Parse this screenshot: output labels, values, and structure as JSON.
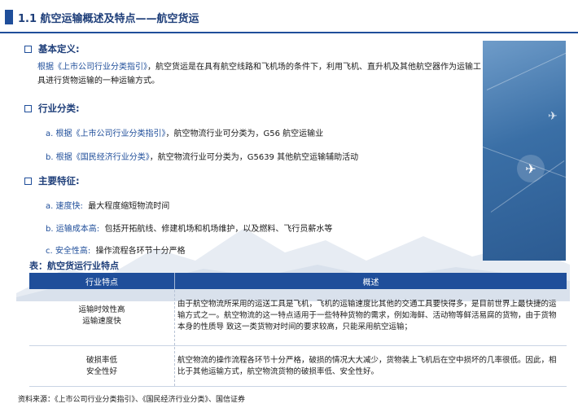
{
  "title": "1.1 航空运输概述及特点——航空货运",
  "sections": {
    "definition": {
      "heading": "基本定义:",
      "source_ref": "根据《上市公司行业分类指引》",
      "text_line1": "，航空货运是在具有航空线路和飞机场的条件下，利用飞机、直升机及其他航空器作为运输工",
      "text_line2": "具进行货物运输的一种运输方式。"
    },
    "classification": {
      "heading": "行业分类:",
      "items": [
        {
          "ref": "a. 根据《上市公司行业分类指引》",
          "text": "，航空物流行业可分类为，G56 航空运输业"
        },
        {
          "ref": "b. 根据《国民经济行业分类》",
          "text": "，航空物流行业可分类为，G5639 其他航空运输辅助活动"
        }
      ]
    },
    "features": {
      "heading": "主要特征:",
      "items": [
        {
          "label": "a.  速度快:",
          "text": "最大程度缩短物流时间"
        },
        {
          "label": "b.  运输成本高:",
          "text": "包括开拓航线、修建机场和机场维护，以及燃料、飞行员薪水等"
        },
        {
          "label": "c.   安全性高:",
          "text": "操作流程各环节十分严格"
        }
      ]
    }
  },
  "table": {
    "title": "表：航空货运行业特点",
    "headers": [
      "行业特点",
      "概述"
    ],
    "rows": [
      {
        "feature_line1": "运输时效性高",
        "feature_line2": "运输速度快",
        "desc": "由于航空物流所采用的运送工具是飞机，飞机的运输速度比其他的交通工具要快得多，是目前世界上最快捷的运输方式之一。航空物流的这一特点适用于一些特种货物的需求，例如海鲜、活动物等鲜活易腐的货物，由于货物本身的性质导 致这一类货物对时间的要求较高，只能采用航空运输；"
      },
      {
        "feature_line1": "破损率低",
        "feature_line2": "安全性好",
        "desc": "航空物流的操作流程各环节十分严格，破损的情况大大减少，货物装上飞机后在空中损坏的几率很低。因此，相比于其他运输方式，航空物流货物的破损率低、安全性好。"
      }
    ]
  },
  "source": "资料来源：《上市公司行业分类指引》、《国民经济行业分类》、国信证券",
  "colors": {
    "accent": "#1f4e9a",
    "heading": "#1f3f7a"
  }
}
